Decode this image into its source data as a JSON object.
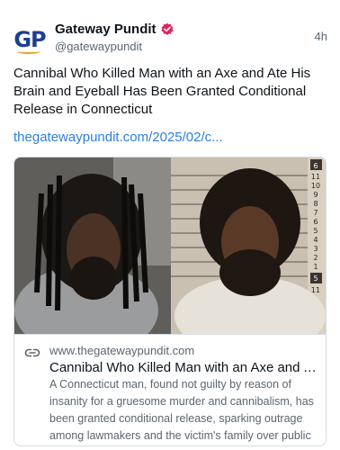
{
  "author": {
    "name": "Gateway Pundit",
    "handle": "@gatewaypundit",
    "avatar_text": "GP",
    "verified_icon": "verified-badge-icon",
    "verified_color": "#e0245e"
  },
  "post": {
    "time": "4h",
    "text": "Cannibal Who Killed Man with an Axe and Ate His Brain and Eyeball Has Been Granted Conditional Release in Connecticut",
    "link": "thegatewaypundit.com/2025/02/c..."
  },
  "card": {
    "domain": "www.thegatewaypundit.com",
    "title": "Cannibal Who Killed Man with an Axe and Ate ...",
    "description": "A Connecticut man, found not guilty by reason of insanity for a gruesome murder and cannibalism, has been granted conditional release, sparking outrage among lawmakers and the victim's family over public ...",
    "link_icon": "link-chain-icon",
    "height_chart_labels": [
      "6",
      "11",
      "10",
      "9",
      "8",
      "7",
      "6",
      "5",
      "4",
      "3",
      "2",
      "1",
      "5",
      "11"
    ]
  },
  "colors": {
    "link": "#2f7fdc",
    "muted": "#5b6670",
    "border": "#d6dde3",
    "avatar_blue": "#1d3f8f",
    "avatar_orange": "#e8a21a"
  }
}
